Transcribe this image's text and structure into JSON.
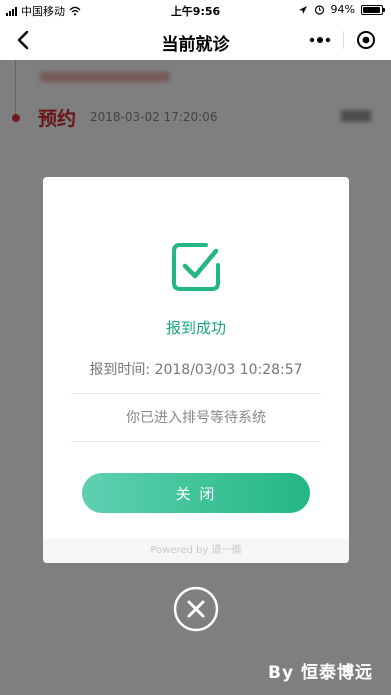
{
  "status_bar": {
    "carrier": "中国移动",
    "time": "上午9:56",
    "battery": "94%",
    "battery_level": 0.94
  },
  "nav": {
    "title": "当前就诊",
    "icons": [
      "back-chevron-icon",
      "more-dots-icon",
      "target-circle-icon"
    ]
  },
  "record": {
    "title": "预约",
    "time": "2018-03-02 17:20:06"
  },
  "modal": {
    "status": "报到成功",
    "checkin_time": "报到时间: 2018/03/03 10:28:57",
    "queue_message": "你已进入排号等待系统",
    "close_label": "关 闭",
    "footer": "Powered by 道一循"
  },
  "watermark": "By 恒泰博远",
  "colors": {
    "accent_green": "#23b782",
    "accent_green_light": "#5fd0b1",
    "record_red": "#d02a2a"
  }
}
